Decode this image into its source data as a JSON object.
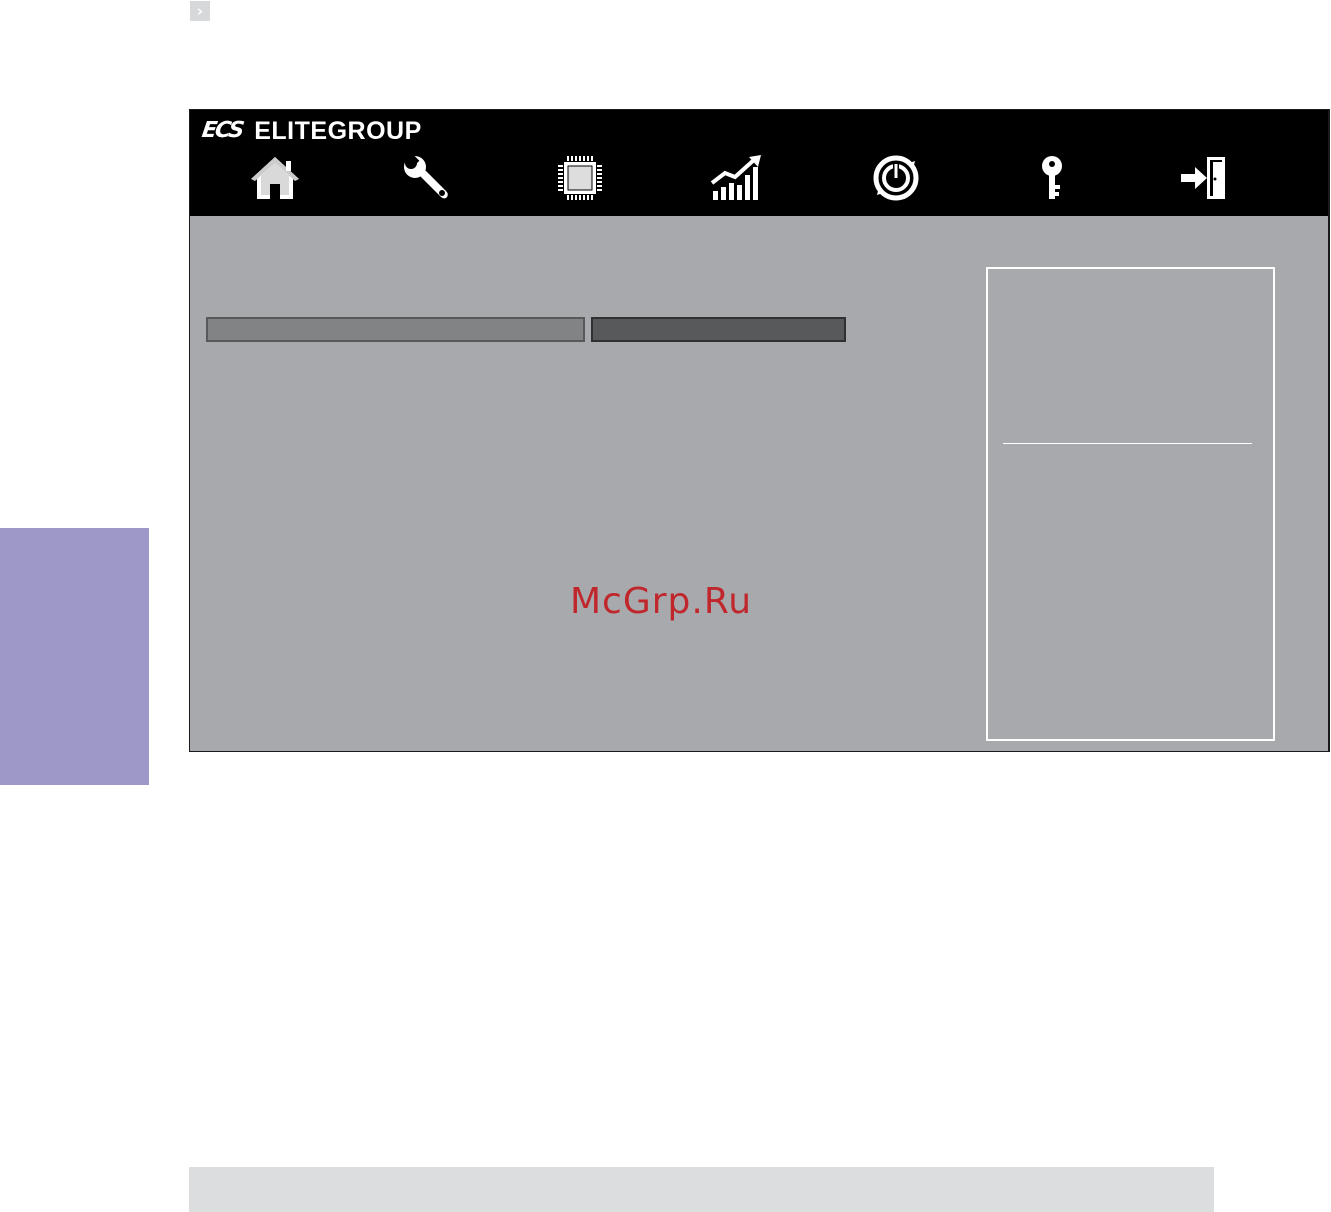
{
  "breadcrumb": {
    "arrow": "›"
  },
  "window": {
    "brand_mark": "ECS",
    "brand_name": "ELITEGROUP"
  },
  "nav": {
    "items": [
      {
        "id": "main",
        "icon": "home-icon"
      },
      {
        "id": "advanced",
        "icon": "wrench-icon"
      },
      {
        "id": "chipset",
        "icon": "chip-icon"
      },
      {
        "id": "mi",
        "icon": "chart-icon"
      },
      {
        "id": "boot",
        "icon": "power-icon"
      },
      {
        "id": "security",
        "icon": "key-icon"
      },
      {
        "id": "exit",
        "icon": "exit-icon"
      }
    ]
  },
  "watermark": "McGrp.Ru",
  "colors": {
    "side_tab": "#9d98c8",
    "window_bg": "#a8a9ac",
    "header_bg": "#000000",
    "watermark": "#c0272d"
  }
}
